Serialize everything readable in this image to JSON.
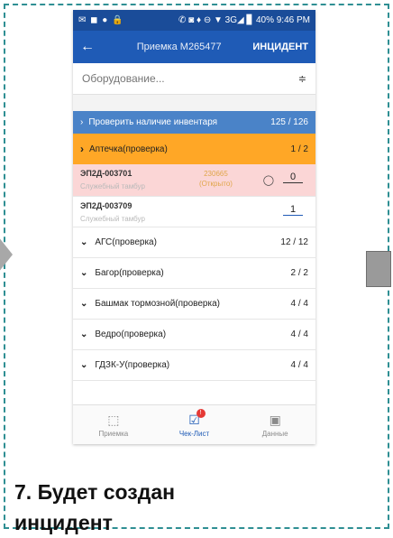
{
  "statusbar": {
    "left_icons": "✉ ◼ ● 🔒",
    "right": "✆ ◙ ♦ ⊖ ▼ 3G◢ ▊ 40% 9:46 PM"
  },
  "appbar": {
    "back": "←",
    "title": "Приемка М265477",
    "action": "ИНЦИДЕНТ"
  },
  "search": {
    "placeholder": "Оборудование...",
    "filter_icon": "≑"
  },
  "check_bar": {
    "chevron": "›",
    "label": "Проверить наличие инвентаря",
    "count": "125 / 126",
    "color": "#4a83c8"
  },
  "group_open": {
    "chevron": "›",
    "label": "Аптечка(проверка)",
    "count": "1 / 2",
    "color": "#ffa726"
  },
  "items": [
    {
      "code": "ЭП2Д-003701",
      "sub": "Служебный тамбур",
      "status_line1": "230665",
      "status_line2": "(Открыто)",
      "comment": "◯",
      "qty": "0"
    },
    {
      "code": "ЭП2Д-003709",
      "sub": "Служебный тамбур",
      "qty": "1"
    }
  ],
  "groups": [
    {
      "chevron": "⌄",
      "label": "АГС(проверка)",
      "count": "12 / 12"
    },
    {
      "chevron": "⌄",
      "label": "Багор(проверка)",
      "count": "2 / 2"
    },
    {
      "chevron": "⌄",
      "label": "Башмак тормозной(проверка)",
      "count": "4 / 4"
    },
    {
      "chevron": "⌄",
      "label": "Ведро(проверка)",
      "count": "4 / 4"
    },
    {
      "chevron": "⌄",
      "label": "ГДЗК-У(проверка)",
      "count": "4 / 4"
    }
  ],
  "nav": [
    {
      "icon": "⬚",
      "label": "Приемка",
      "active": false
    },
    {
      "icon": "☑",
      "label": "Чек-Лист",
      "active": true,
      "badge": "!"
    },
    {
      "icon": "▣",
      "label": "Данные",
      "active": false
    }
  ],
  "caption": {
    "line1": "7. Будет создан",
    "line2": "инцидент"
  }
}
